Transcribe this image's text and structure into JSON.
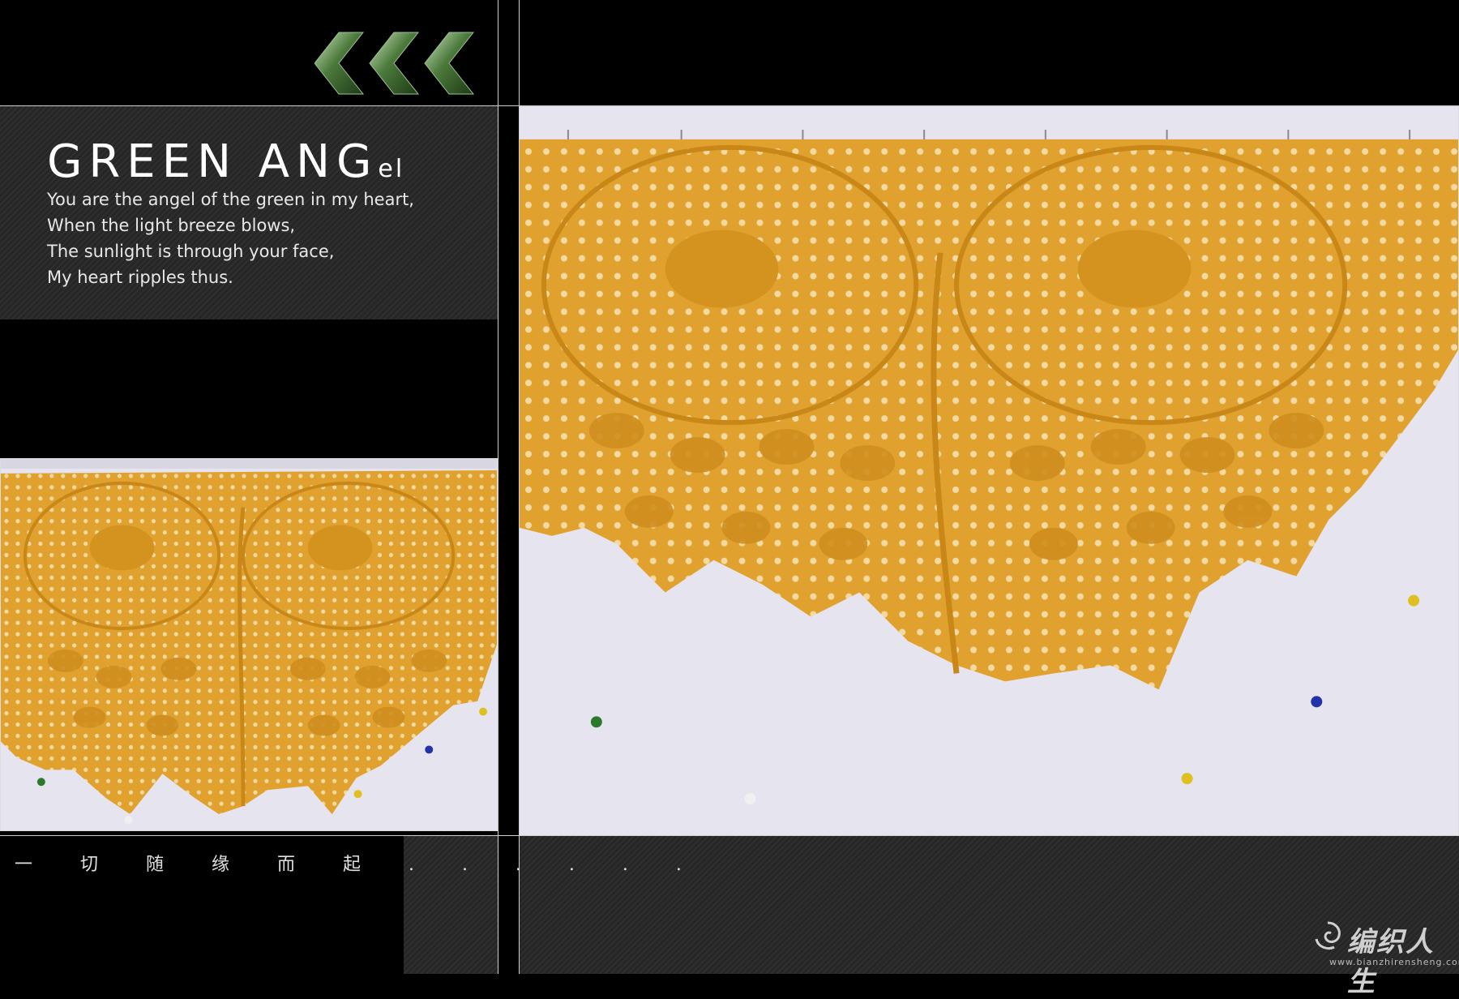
{
  "title": {
    "main": "GREEN ANG",
    "suffix": "el"
  },
  "poem": [
    "You are the angel of the green in my heart,",
    "When the light breeze blows,",
    "The sunlight is through your face,",
    "My heart ripples thus."
  ],
  "caption": "一 切 随 缘 而 起 . . . . . .",
  "watermark": {
    "name": "编织人生",
    "url": "www.bianzhirensheng.com"
  },
  "icons": {
    "arrows": "triple-chevron-left-icon",
    "logo": "swirl-logo-icon"
  },
  "colors": {
    "yarn": "#e0a12e",
    "yarn_dark": "#c98718",
    "cloth": "#e6e4ee",
    "panel": "#2b2b2b",
    "arrow": "#4e7a3a"
  }
}
